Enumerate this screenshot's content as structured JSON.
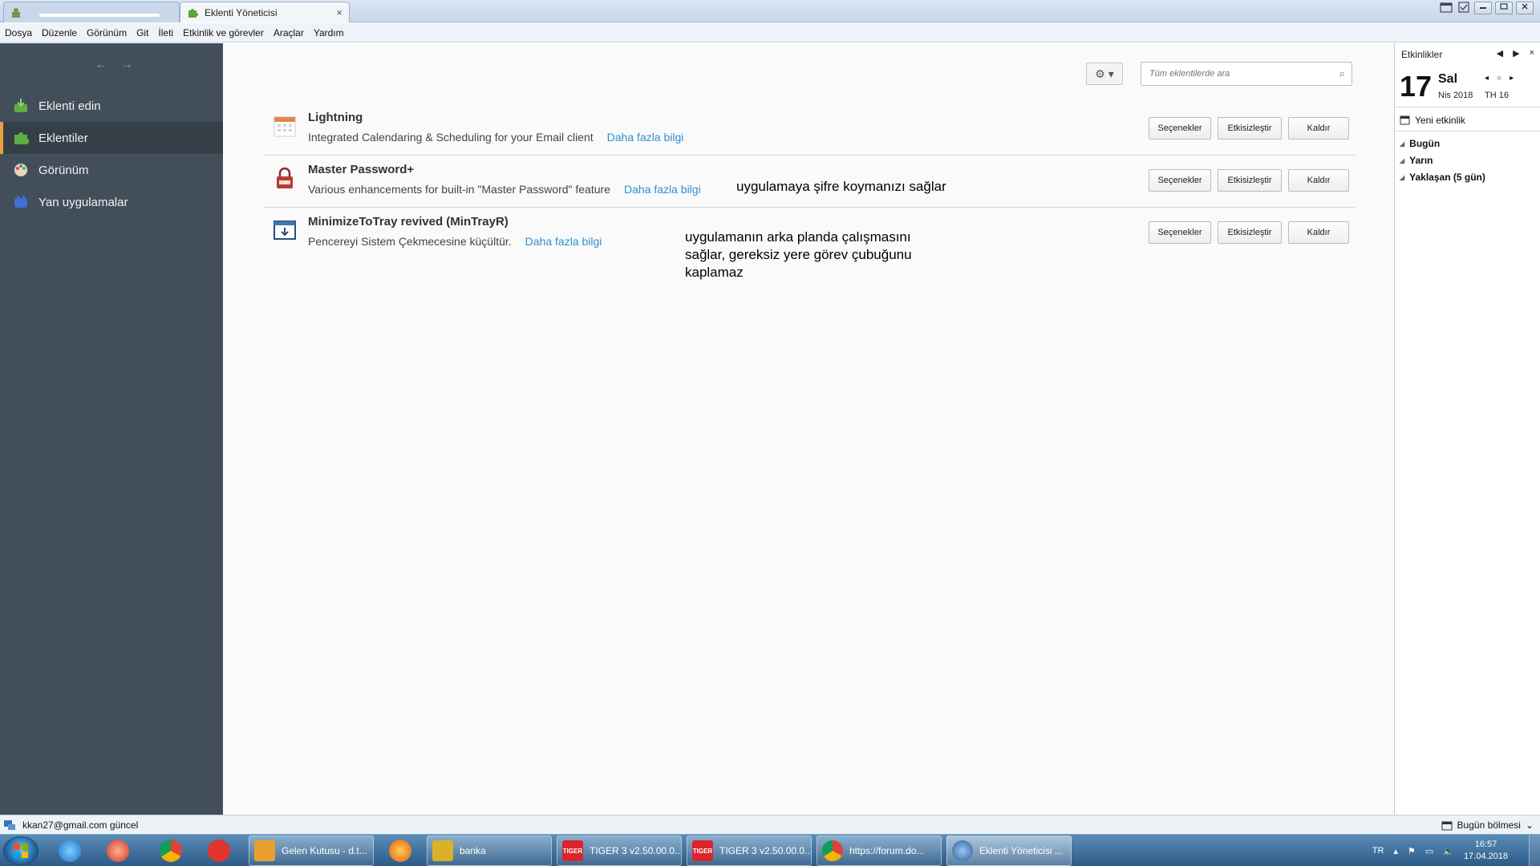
{
  "tabs": [
    {
      "label": "",
      "active": false
    },
    {
      "label": "Eklenti Yöneticisi",
      "active": true,
      "close": "×"
    }
  ],
  "menu": [
    "Dosya",
    "Düzenle",
    "Görünüm",
    "Git",
    "İleti",
    "Etkinlik ve görevler",
    "Araçlar",
    "Yardım"
  ],
  "sidebar": {
    "back": "←",
    "forward": "→",
    "items": [
      {
        "label": "Eklenti edin",
        "icon": "get-addons-icon"
      },
      {
        "label": "Eklentiler",
        "icon": "puzzle-icon",
        "selected": true
      },
      {
        "label": "Görünüm",
        "icon": "palette-icon"
      },
      {
        "label": "Yan uygulamalar",
        "icon": "plugin-icon"
      }
    ]
  },
  "toolbar": {
    "gear": "⚙ ▾",
    "search_placeholder": "Tüm eklentilerde ara",
    "search_icon": "⌕"
  },
  "addons": [
    {
      "name": "Lightning",
      "description": "Integrated Calendaring & Scheduling for your Email client",
      "more": "Daha fazla bilgi",
      "icon": "calendar-icon",
      "buttons": [
        "Seçenekler",
        "Etkisizleştir",
        "Kaldır"
      ]
    },
    {
      "name": "Master Password+",
      "description": "Various enhancements for built-in \"Master Password\" feature",
      "more": "Daha fazla bilgi",
      "icon": "padlock-icon",
      "buttons": [
        "Seçenekler",
        "Etkisizleştir",
        "Kaldır"
      ]
    },
    {
      "name": "MinimizeToTray revived (MinTrayR)",
      "description": "Pencereyi Sistem Çekmecesine küçültür.",
      "more": "Daha fazla bilgi",
      "icon": "tray-icon",
      "buttons": [
        "Seçenekler",
        "Etkisizleştir",
        "Kaldır"
      ]
    }
  ],
  "notes": {
    "master_password": "uygulamaya şifre koymanızı sağlar",
    "mintray_lines": [
      "uygulamanın arka planda çalışmasını",
      "sağlar, gereksiz yere görev çubuğunu",
      "kaplamaz"
    ]
  },
  "today_pane": {
    "title": "Etkinlikler",
    "prev": "◀",
    "next": "▶",
    "close": "×",
    "day_number": "17",
    "day_name": "Sal",
    "month_year": "Nis 2018",
    "week": "TH 16",
    "new_event": "Yeni etkinlik",
    "groups": [
      "Bugün",
      "Yarın",
      "Yaklaşan (5 gün)"
    ]
  },
  "statusbar": {
    "text": "kkan27@gmail.com güncel",
    "today_button": "Bugün bölmesi"
  },
  "taskbar": {
    "tasks": [
      {
        "label": "Gelen Kutusu - d.t...",
        "color": "#e8a22c"
      },
      {
        "label": "banka",
        "color": "#d9b22a"
      },
      {
        "label": "TIGER 3 v2.50.00.0...",
        "color": "#d8262c"
      },
      {
        "label": "TIGER 3 v2.50.00.0...",
        "color": "#d8262c"
      },
      {
        "label": "https://forum.do...",
        "color": "#4c8bf5"
      },
      {
        "label": "Eklenti Yöneticisi ...",
        "color": "#3a72b5"
      }
    ],
    "tiger_badge": "TIGER",
    "lang": "TR",
    "time": "16:57",
    "date": "17.04.2018"
  },
  "colors": {
    "sidebar_bg": "#424f5a",
    "accent": "#e8a03a",
    "link": "#2f8fd0"
  }
}
